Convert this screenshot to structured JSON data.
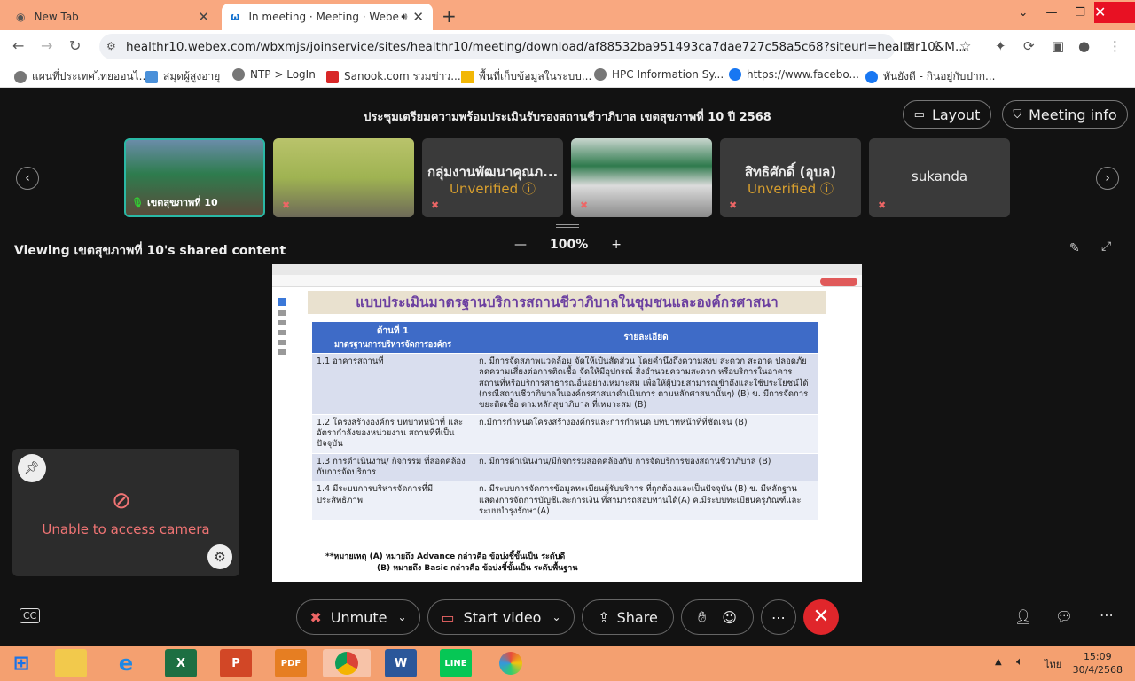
{
  "browser": {
    "tabs": [
      {
        "title": "New Tab"
      },
      {
        "title": "In meeting · Meeting · Webe"
      }
    ],
    "url": "healthr10.webex.com/wbxmjs/joinservice/sites/healthr10/meeting/download/af88532ba951493ca7dae727c58a5c68?siteurl=healthr10&M...",
    "bookmarks": [
      "แผนที่ประเทศไทยออนไ...",
      "สมุดผู้สูงอายุ",
      "NTP > LogIn",
      "Sanook.com รวมข่าว...",
      "พื้นที่เก็บข้อมูลในระบบ...",
      "HPC Information Sy...",
      "https://www.facebo...",
      "ทันยังดี - กินอยู่กับปาก..."
    ]
  },
  "meeting": {
    "title": "ประชุมเตรียมความพร้อมประเมินรับรองสถานชีวาภิบาล เขตสุขภาพที่ 10 ปี 2568",
    "layout_label": "Layout",
    "info_label": "Meeting info",
    "participants": [
      {
        "name": "เขตสุขภาพที่ 10",
        "has_video": true
      },
      {
        "name": "",
        "has_video": true
      },
      {
        "name": "กลุ่มงานพัฒนาคุณภ...",
        "status": "Unverified"
      },
      {
        "name": "",
        "has_video": true
      },
      {
        "name": "สิทธิศักดิ์ (อุบล)",
        "status": "Unverified"
      },
      {
        "name": "sukanda"
      }
    ],
    "viewing": "Viewing เขตสุขภาพที่ 10's shared content",
    "zoom": "100%",
    "camera_error": "Unable to access camera",
    "controls": {
      "unmute": "Unmute",
      "start_video": "Start video",
      "share": "Share"
    }
  },
  "document": {
    "title": "แบบประเมินมาตรฐานบริการสถานชีวาภิบาลในชุมชนและองค์กรศาสนา",
    "head_left_1": "ด้านที่ 1",
    "head_left_2": "มาตรฐานการบริหารจัดการองค์กร",
    "head_right": "รายละเอียด",
    "rows": [
      {
        "item": "1.1 อาคารสถานที่",
        "detail": "ก. มีการจัดสภาพแวดล้อม จัดให้เป็นสัดส่วน โดยคำนึงถึงความสงบ สะดวก สะอาด ปลอดภัย ลดความเสี่ยงต่อการติดเชื้อ จัดให้มีอุปกรณ์ สิ่งอำนวยความสะดวก หรือบริการในอาคาร สถานที่หรือบริการสาธารณอื่นอย่างเหมาะสม เพื่อให้ผู้ป่วยสามารถเข้าถึงและใช้ประโยชน์ได้ (กรณีสถานชีวาภิบาลในองค์กรศาสนาดำเนินการ ตามหลักศาสนานั้นๆ) (B)  ข. มีการจัดการขยะติดเชื้อ ตามหลักสุขาภิบาล ที่เหมาะสม (B)"
      },
      {
        "item": "1.2 โครงสร้างองค์กร บทบาทหน้าที่ และอัตรากำลังของหน่วยงาน สถานที่ที่เป็นปัจจุบัน",
        "detail": "ก.มีการกำหนดโครงสร้างองค์กรและการกำหนด บทบาทหน้าที่ที่ชัดเจน (B)"
      },
      {
        "item": "1.3 การดำเนินงาน/ กิจกรรม ที่สอดคล้องกับการจัดบริการ",
        "detail": "ก. มีการดำเนินงาน/มีกิจกรรมสอดคล้องกับ การจัดบริการของสถานชีวาภิบาล (B)"
      },
      {
        "item": "1.4 มีระบบการบริหารจัดการที่มีประสิทธิภาพ",
        "detail": "ก. มีระบบการจัดการข้อมูลทะเบียนผู้รับบริการ ที่ถูกต้องและเป็นปัจจุบัน (B)  ข. มีหลักฐานแสดงการจัดการบัญชีและการเงิน ที่สามารถสอบทานได้(A) ค.มีระบบทะเบียนครุภัณฑ์และระบบบำรุงรักษา(A)"
      }
    ],
    "note1": "**หมายเหตุ (A) หมายถึง Advance กล่าวคือ ข้อบ่งชี้ขั้นเป็น ระดับดี",
    "note2": "(B) หมายถึง Basic กล่าวคือ ข้อบ่งชี้ขั้นเป็น ระดับพื้นฐาน"
  },
  "taskbar": {
    "time": "15:09",
    "date": "30/4/2568",
    "lang": "ไทย"
  }
}
